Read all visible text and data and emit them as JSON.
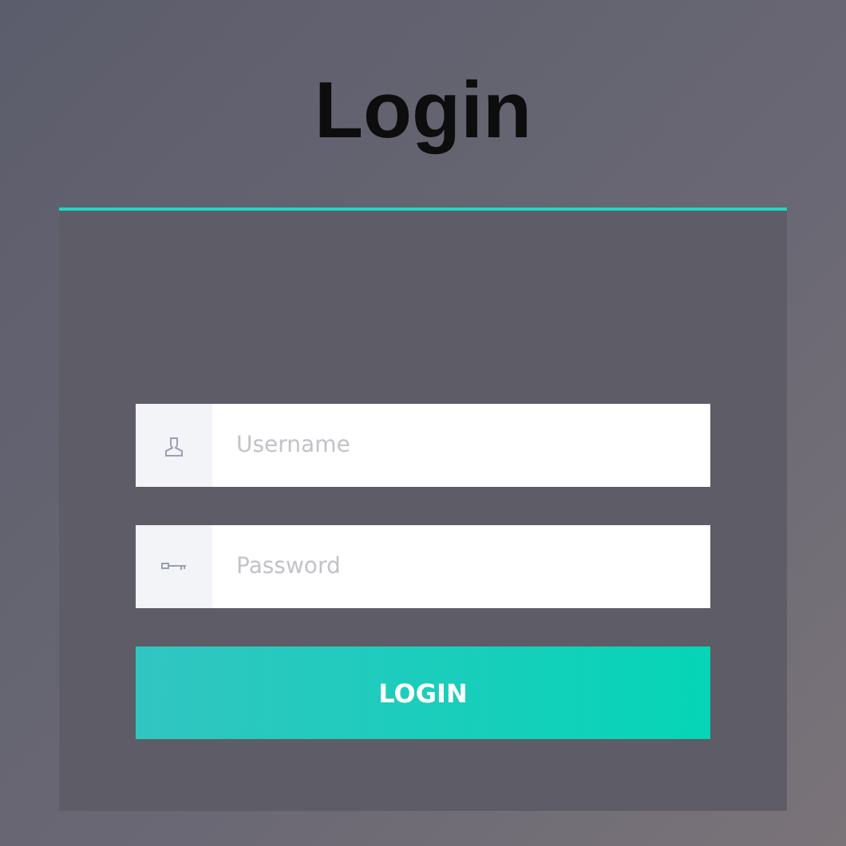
{
  "title": "Login",
  "fields": [
    {
      "kind": "username",
      "placeholder": "Username"
    },
    {
      "kind": "password",
      "placeholder": "Password"
    }
  ],
  "button": "LOGIN"
}
